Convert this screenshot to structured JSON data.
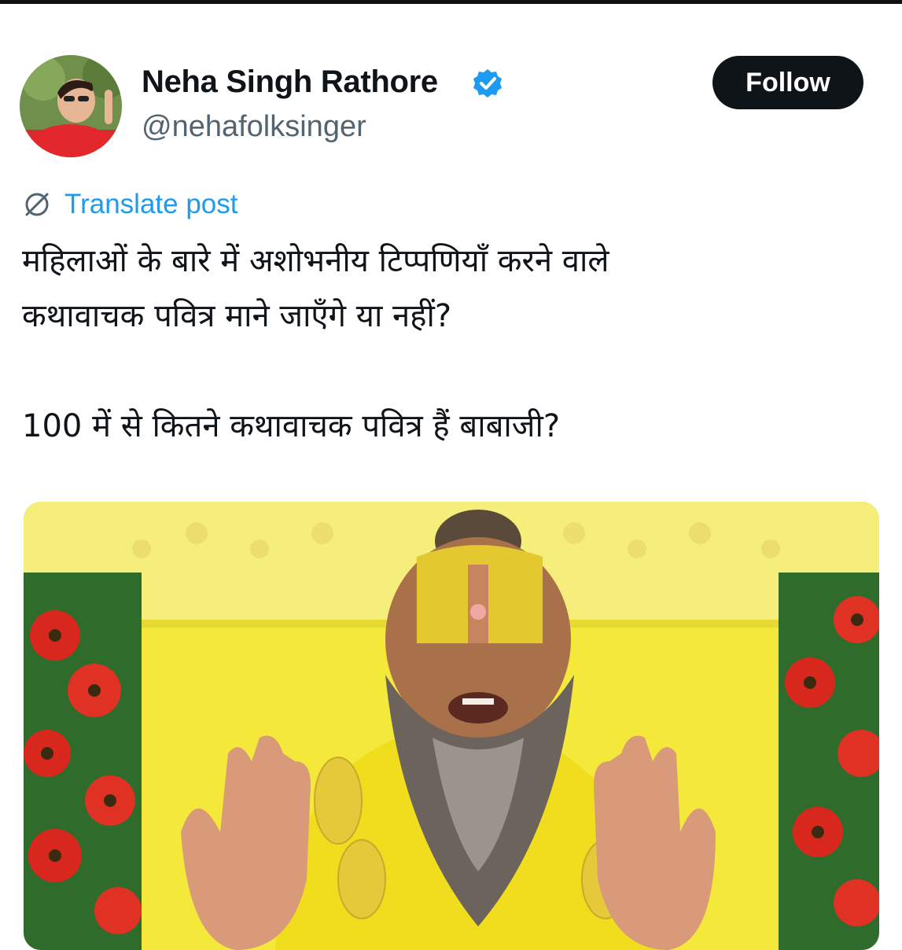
{
  "post": {
    "author": {
      "display_name": "Neha Singh Rathore",
      "handle": "@nehafolksinger",
      "verified": true,
      "verified_icon": "verified-badge-icon"
    },
    "follow_label": "Follow",
    "translate_label": "Translate post",
    "text_lines": [
      "महिलाओं के बारे में अशोभनीय टिप्पणियाँ करने वाले",
      "कथावाचक पवित्र माने जाएँगे या नहीं?",
      "100 में से कितने कथावाचक पवित्र हैं बाबाजी?"
    ]
  },
  "colors": {
    "accent": "#1d9bf0",
    "follow_bg": "#0f1419",
    "secondary_text": "#536471",
    "media_yellow": "#f2e430"
  }
}
